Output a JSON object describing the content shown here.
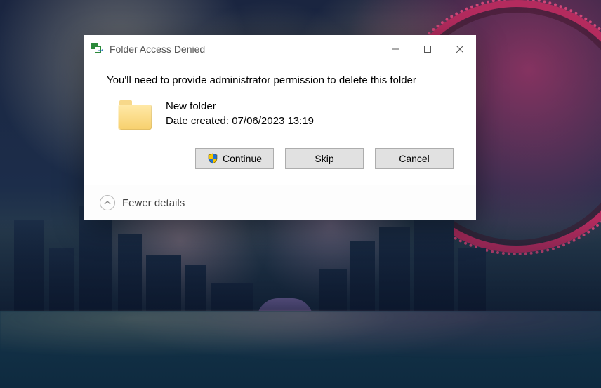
{
  "dialog": {
    "title": "Folder Access Denied",
    "message": "You'll need to provide administrator permission to delete this folder",
    "item": {
      "name": "New folder",
      "date_created_label": "Date created: 07/06/2023 13:19"
    },
    "buttons": {
      "continue": "Continue",
      "skip": "Skip",
      "cancel": "Cancel"
    },
    "footer": {
      "toggle_label": "Fewer details"
    }
  }
}
